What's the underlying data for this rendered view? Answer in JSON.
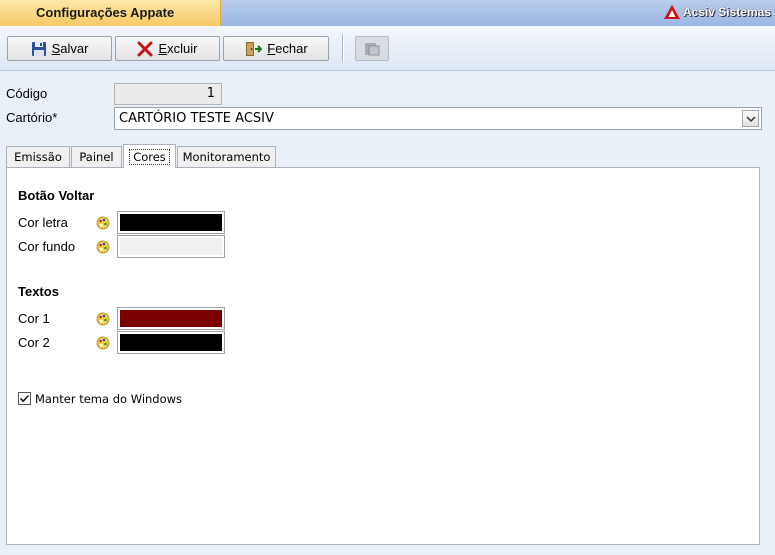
{
  "window": {
    "title": "Configurações Appate",
    "brand": "Acsiv Sistemas",
    "brand_color": "#d01010"
  },
  "toolbar": {
    "save_label": "Salvar",
    "delete_label": "Excluir",
    "close_label": "Fechar",
    "extra_icon": "disabled-document-icon"
  },
  "form": {
    "codigo_label": "Código",
    "codigo_value": "1",
    "cartorio_label": "Cartório*",
    "cartorio_value": "CARTÓRIO TESTE ACSIV"
  },
  "tabs": [
    {
      "label": "Emissão"
    },
    {
      "label": "Painel"
    },
    {
      "label": "Cores",
      "active": true
    },
    {
      "label": "Monitoramento"
    }
  ],
  "cores": {
    "botao_voltar": {
      "title": "Botão Voltar",
      "cor_letra_label": "Cor letra",
      "cor_letra_color": "#000000",
      "cor_fundo_label": "Cor fundo",
      "cor_fundo_color": "#f0f0f0"
    },
    "textos": {
      "title": "Textos",
      "cor1_label": "Cor 1",
      "cor1_color": "#7a0000",
      "cor2_label": "Cor 2",
      "cor2_color": "#000000"
    },
    "manter_tema_label": "Manter tema do Windows",
    "manter_tema_checked": true
  }
}
